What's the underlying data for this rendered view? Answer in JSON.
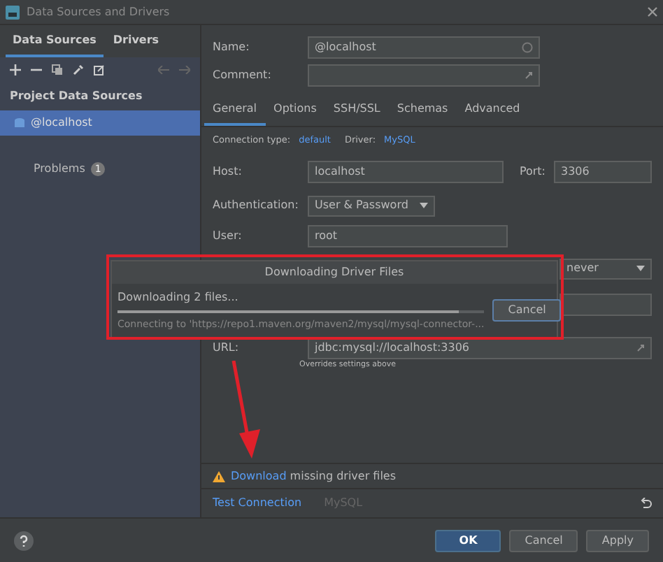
{
  "window": {
    "title": "Data Sources and Drivers"
  },
  "sidebar": {
    "tabs": [
      {
        "label": "Data Sources",
        "selected": true
      },
      {
        "label": "Drivers",
        "selected": false
      }
    ],
    "section": "Project Data Sources",
    "items": [
      {
        "label": "@localhost",
        "selected": true
      }
    ],
    "problems": {
      "label": "Problems",
      "count": "1"
    }
  },
  "form": {
    "name": {
      "label": "Name:",
      "value": "@localhost"
    },
    "comment": {
      "label": "Comment:"
    },
    "tabs": [
      {
        "label": "General",
        "selected": true
      },
      {
        "label": "Options",
        "selected": false
      },
      {
        "label": "SSH/SSL",
        "selected": false
      },
      {
        "label": "Schemas",
        "selected": false
      },
      {
        "label": "Advanced",
        "selected": false
      }
    ],
    "connection_type": {
      "label": "Connection type:",
      "value": "default"
    },
    "driver": {
      "label": "Driver:",
      "value": "MySQL"
    },
    "host": {
      "label": "Host:",
      "value": "localhost"
    },
    "port": {
      "label": "Port:",
      "value": "3306"
    },
    "authentication": {
      "label": "Authentication:",
      "value": "User & Password"
    },
    "user": {
      "label": "User:",
      "value": "root"
    },
    "save": {
      "value": "never"
    },
    "url": {
      "label": "URL:",
      "value": "jdbc:mysql://localhost:3306",
      "hint": "Overrides settings above"
    }
  },
  "warning": {
    "link": "Download",
    "text": "missing driver files"
  },
  "footer_links": [
    {
      "label": "Test Connection",
      "disabled": false
    },
    {
      "label": "MySQL",
      "disabled": true
    }
  ],
  "buttons": [
    {
      "label": "OK",
      "kind": "primary"
    },
    {
      "label": "Cancel",
      "kind": "default"
    },
    {
      "label": "Apply",
      "kind": "default"
    }
  ],
  "dialog": {
    "title": "Downloading Driver Files",
    "status": "Downloading 2 files...",
    "level": 0.93,
    "detail": "Connecting to 'https://repo1.maven.org/maven2/mysql/mysql-connector-...",
    "button": "Cancel"
  }
}
